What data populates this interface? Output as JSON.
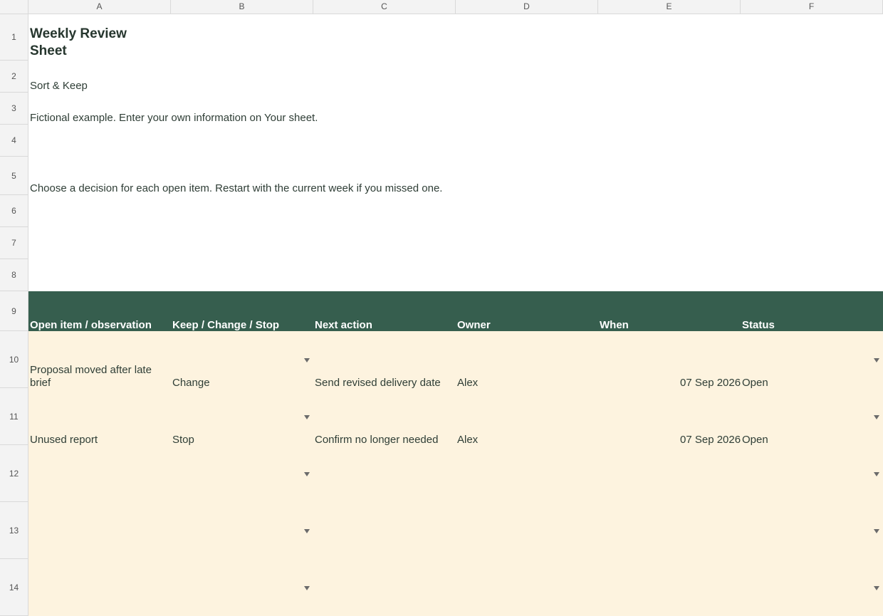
{
  "columns": [
    "A",
    "B",
    "C",
    "D",
    "E",
    "F"
  ],
  "rows": [
    "1",
    "2",
    "3",
    "4",
    "5",
    "6",
    "7",
    "8",
    "9",
    "10",
    "11",
    "12",
    "13",
    "14"
  ],
  "sheet": {
    "title_line1": "Weekly Review",
    "title_line2": "Sheet",
    "subtitle": "Sort & Keep",
    "note": "Fictional example. Enter your own information on Your sheet.",
    "instruction": "Choose a decision for each open item. Restart with the current week if you missed one."
  },
  "table": {
    "headers": [
      "Open item / observation",
      "Keep / Change / Stop",
      "Next action",
      "Owner",
      "When",
      "Status"
    ],
    "rows": [
      {
        "item_line1": "Proposal moved after late",
        "item_line2": "brief",
        "decision": "Change",
        "action": "Send revised delivery date",
        "owner": "Alex",
        "when": "07 Sep 2026",
        "status": "Open"
      },
      {
        "item_line1": "Unused report",
        "item_line2": "",
        "decision": "Stop",
        "action": "Confirm no longer needed",
        "owner": "Alex",
        "when": "07 Sep 2026",
        "status": "Open"
      }
    ]
  }
}
